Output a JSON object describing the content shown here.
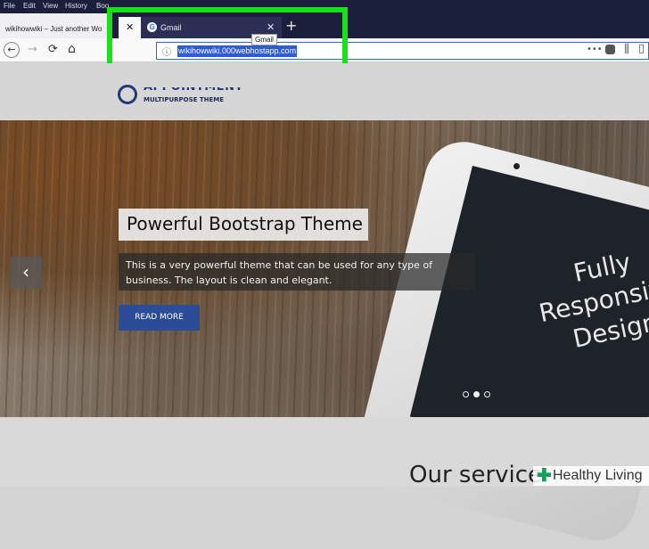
{
  "menubar": {
    "items": [
      "File",
      "Edit",
      "View",
      "History",
      "Boo"
    ]
  },
  "tabs": {
    "left_tab_title": "wikihowwiki – Just another Wo",
    "close_glyph": "✕",
    "gmail_title": "Gmail",
    "new_tab_glyph": "+"
  },
  "tooltip": {
    "text": "Gmail"
  },
  "toolbar": {
    "back_glyph": "←",
    "forward_glyph": "→",
    "reload_glyph": "⟳",
    "home_glyph": "⌂",
    "url": "wikihowwiki.000webhostapp.com",
    "info_glyph": "ⓘ"
  },
  "site": {
    "logo_text": "APPOINTMENT",
    "logo_subtitle": "MULTIPURPOSE THEME"
  },
  "hero": {
    "title": "Powerful Bootstrap Theme",
    "text": "This is a very powerful theme that can be used for any type of business. The layout is clean and elegant.",
    "button": "READ MORE",
    "prev_glyph": "‹",
    "phone_text": "Fully Responsive Design",
    "slide_count": 3,
    "active_slide": 2
  },
  "services": {
    "title": "Our service"
  },
  "watermark": {
    "text": "Healthy Living",
    "mark": "✚"
  },
  "colors": {
    "highlight": "#19e119",
    "chrome_dark": "#1b1f3c",
    "button_blue": "#2b4c96",
    "url_selection": "#2f5ad8"
  }
}
